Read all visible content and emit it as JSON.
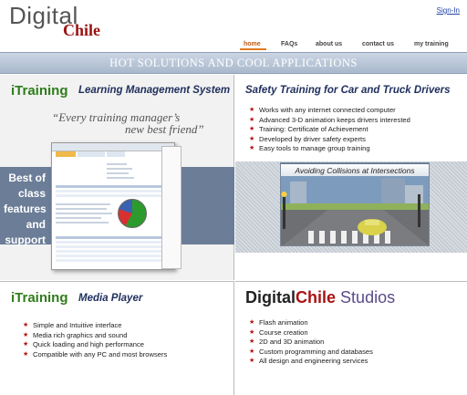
{
  "header": {
    "logo_top": "Digital",
    "logo_bottom": "Chile",
    "signin": "Sign-In"
  },
  "nav": [
    {
      "label": "home",
      "active": true
    },
    {
      "label": "FAQs",
      "active": false
    },
    {
      "label": "about us",
      "active": false
    },
    {
      "label": "contact us",
      "active": false
    },
    {
      "label": "my training",
      "active": false
    }
  ],
  "banner": "HOT SOLUTIONS AND COOL APPLICATIONS",
  "lms": {
    "brand": "iTraining",
    "title": "Learning Management System",
    "quote_line1": "“Every training manager’s",
    "quote_line2": "new best friend”",
    "stripe_lines": [
      "Best of",
      "class",
      "features",
      "and",
      "support"
    ]
  },
  "safety": {
    "title": "Safety Training for Car and Truck Drivers",
    "bullets": [
      "Works with any internet connected computer",
      "Advanced 3-D animation keeps drivers interested",
      "Training: Certificate of Achievement",
      "Developed by driver safety experts",
      "Easy tools to manage group training"
    ],
    "video_title": "Avoiding Collisions at Intersections"
  },
  "player": {
    "brand": "iTraining",
    "title": "Media Player",
    "bullets": [
      "Simple and Intuitive interface",
      "Media rich graphics and sound",
      "Quick loading and high performance",
      "Compatible with any PC and most browsers"
    ]
  },
  "studios": {
    "word1": "Digital",
    "word2": "Chile",
    "word3": "Studios",
    "bullets": [
      "Flash animation",
      "Course creation",
      "2D and 3D animation",
      "Custom programming and databases",
      "All design and engineering services"
    ]
  },
  "colors": {
    "brand_red": "#9a1111",
    "brand_green": "#2e7d1a",
    "title_navy": "#21305e",
    "nav_active": "#c05a12",
    "banner": "#a9b8cc"
  }
}
